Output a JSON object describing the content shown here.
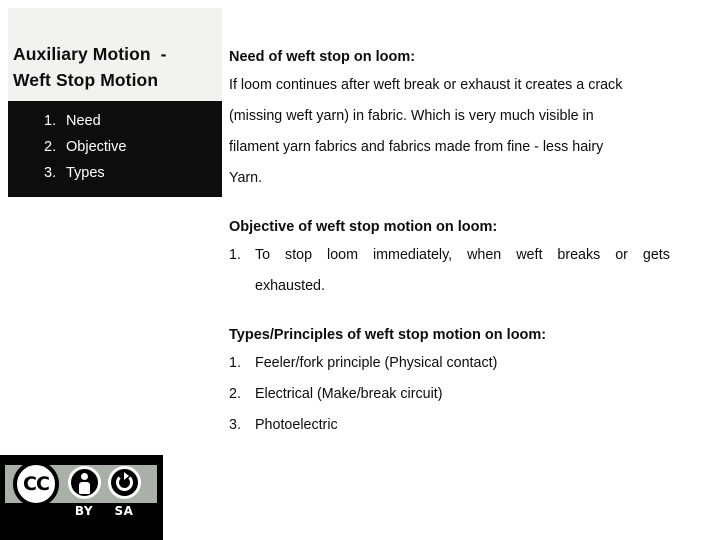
{
  "slide": {
    "title_lines": [
      "Auxiliary Motion  -",
      "Weft Stop Motion"
    ],
    "agenda": [
      {
        "num": "1.",
        "label": "Need"
      },
      {
        "num": "2.",
        "label": "Objective"
      },
      {
        "num": "3.",
        "label": "Types"
      }
    ],
    "sections": {
      "need": {
        "heading": "Need of weft stop on loom:",
        "lines": [
          "If loom continues after weft break or exhaust it creates a crack",
          "(missing weft yarn) in fabric. Which is very much visible in",
          "filament yarn fabrics and fabrics made from fine - less hairy",
          "Yarn."
        ]
      },
      "objective": {
        "heading": "Objective of weft stop motion on loom:",
        "item_num": "1.",
        "justified_words": [
          "To",
          "stop",
          "loom",
          "immediately,",
          "when",
          "weft",
          "breaks",
          "or",
          "gets"
        ],
        "continuation": "exhausted."
      },
      "types": {
        "heading": "Types/Principles of weft stop motion on loom:",
        "items": [
          {
            "num": "1.",
            "label": "Feeler/fork principle (Physical contact)"
          },
          {
            "num": "2.",
            "label": "Electrical (Make/break circuit)"
          },
          {
            "num": "3.",
            "label": "Photoelectric"
          }
        ]
      }
    },
    "license_badge": {
      "cc_glyph": "CC",
      "by_caption": "BY",
      "sa_caption": "SA"
    },
    "colors": {
      "title_block_bg": "#f2f2f0",
      "agenda_block_bg": "#0d0d0d",
      "text": "#0d0d0d",
      "badge_bg": "#000000",
      "badge_band": "#a8b0a8"
    }
  }
}
